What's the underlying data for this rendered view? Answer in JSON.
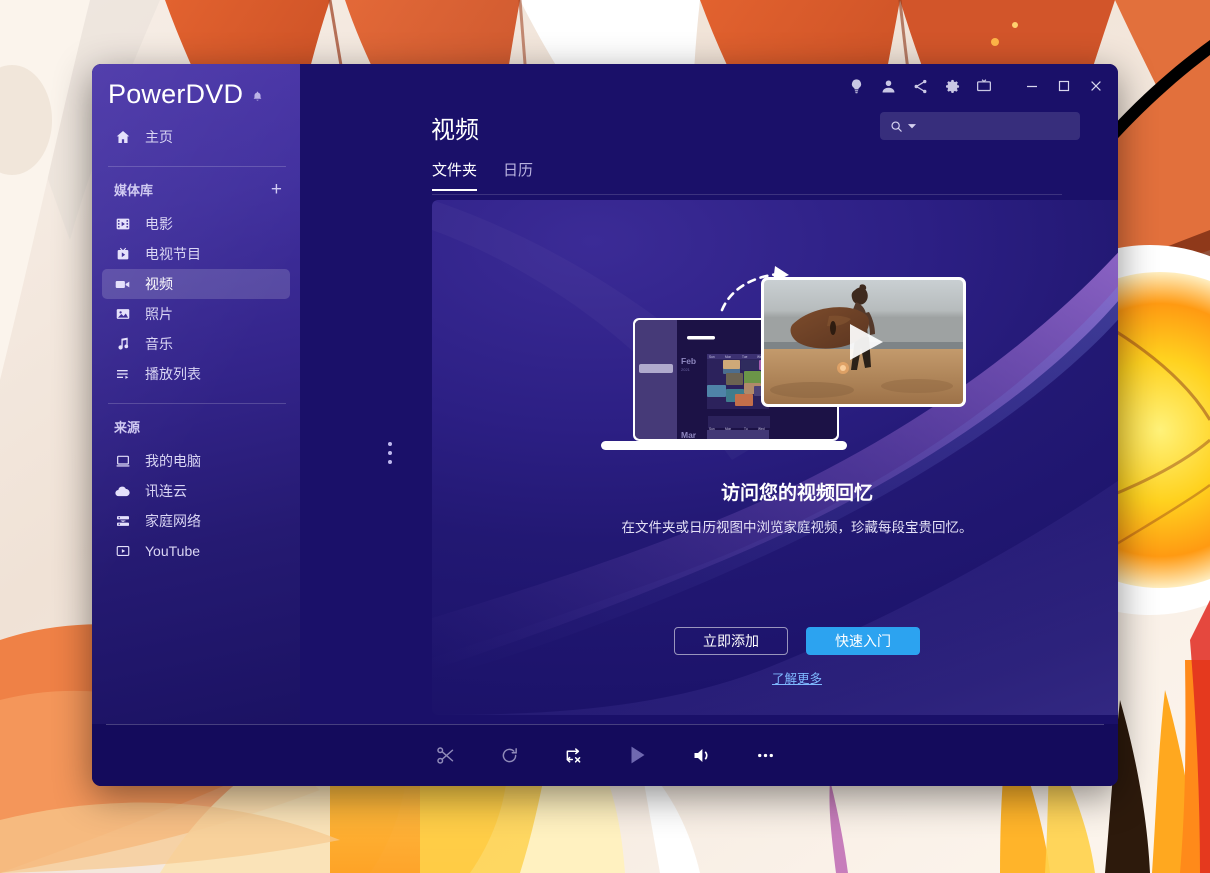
{
  "window": {
    "brand": "PowerDVD",
    "titlebar_icons": [
      {
        "name": "lightbulb-icon",
        "label": "提示"
      },
      {
        "name": "user-icon",
        "label": "账户"
      },
      {
        "name": "share-icon",
        "label": "分享"
      },
      {
        "name": "gear-icon",
        "label": "设置"
      },
      {
        "name": "tv-cast-icon",
        "label": "投放到电视"
      }
    ],
    "controls": {
      "minimize": "─",
      "maximize": "□",
      "close": "✕"
    }
  },
  "sidebar": {
    "bell_icon": "notification-bell-icon",
    "home": {
      "label": "主页",
      "icon": "home-icon"
    },
    "library": {
      "title": "媒体库",
      "add_label": "+",
      "items": [
        {
          "label": "电影",
          "icon": "movie-clapper-icon",
          "selected": false
        },
        {
          "label": "电视节目",
          "icon": "tv-icon",
          "selected": false
        },
        {
          "label": "视频",
          "icon": "video-camera-icon",
          "selected": true
        },
        {
          "label": "照片",
          "icon": "photo-icon",
          "selected": false
        },
        {
          "label": "音乐",
          "icon": "music-note-icon",
          "selected": false
        },
        {
          "label": "播放列表",
          "icon": "playlist-icon",
          "selected": false
        }
      ]
    },
    "sources": {
      "title": "来源",
      "items": [
        {
          "label": "我的电脑",
          "icon": "computer-icon"
        },
        {
          "label": "讯连云",
          "icon": "cloud-icon"
        },
        {
          "label": "家庭网络",
          "icon": "home-network-icon"
        },
        {
          "label": "YouTube",
          "icon": "youtube-icon"
        }
      ]
    },
    "resize_handle": "sidebar-resize-handle"
  },
  "main": {
    "page_title": "视频",
    "search": {
      "placeholder": "",
      "value": "",
      "icon": "search-icon",
      "dropdown_icon": "chevron-down-icon"
    },
    "tabs": [
      {
        "label": "文件夹",
        "active": true
      },
      {
        "label": "日历",
        "active": false
      }
    ],
    "empty_state": {
      "title": "访问您的视频回忆",
      "subtitle": "在文件夹或日历视图中浏览家庭视频，珍藏每段宝贵回忆。",
      "primary_button": "快速入门",
      "secondary_button": "立即添加",
      "link": "了解更多",
      "illustration": {
        "name": "laptop-calendar-and-video-illustration",
        "calendar_months": [
          "Feb",
          "Mar"
        ],
        "calendar_year": "2021",
        "play_overlay": "play-icon",
        "arrow": "curved-arrow-icon"
      }
    }
  },
  "transport": [
    {
      "name": "cut-scissors-icon",
      "label": "剪辑",
      "state": "dim"
    },
    {
      "name": "rotate-icon",
      "label": "旋转",
      "state": "dim"
    },
    {
      "name": "repeat-off-icon",
      "label": "重复",
      "state": "bright"
    },
    {
      "name": "play-icon",
      "label": "播放",
      "state": "play"
    },
    {
      "name": "volume-icon",
      "label": "音量",
      "state": "bright"
    },
    {
      "name": "more-ellipsis-icon",
      "label": "更多",
      "state": "bright"
    }
  ],
  "colors": {
    "accent_blue": "#2ca3f0",
    "link_blue": "#7fb9ff",
    "window_bg": "#1a1069",
    "bottom_bar": "#140b5c",
    "sidebar_top": "#4a35a8",
    "sidebar_bottom": "#1b1263"
  }
}
